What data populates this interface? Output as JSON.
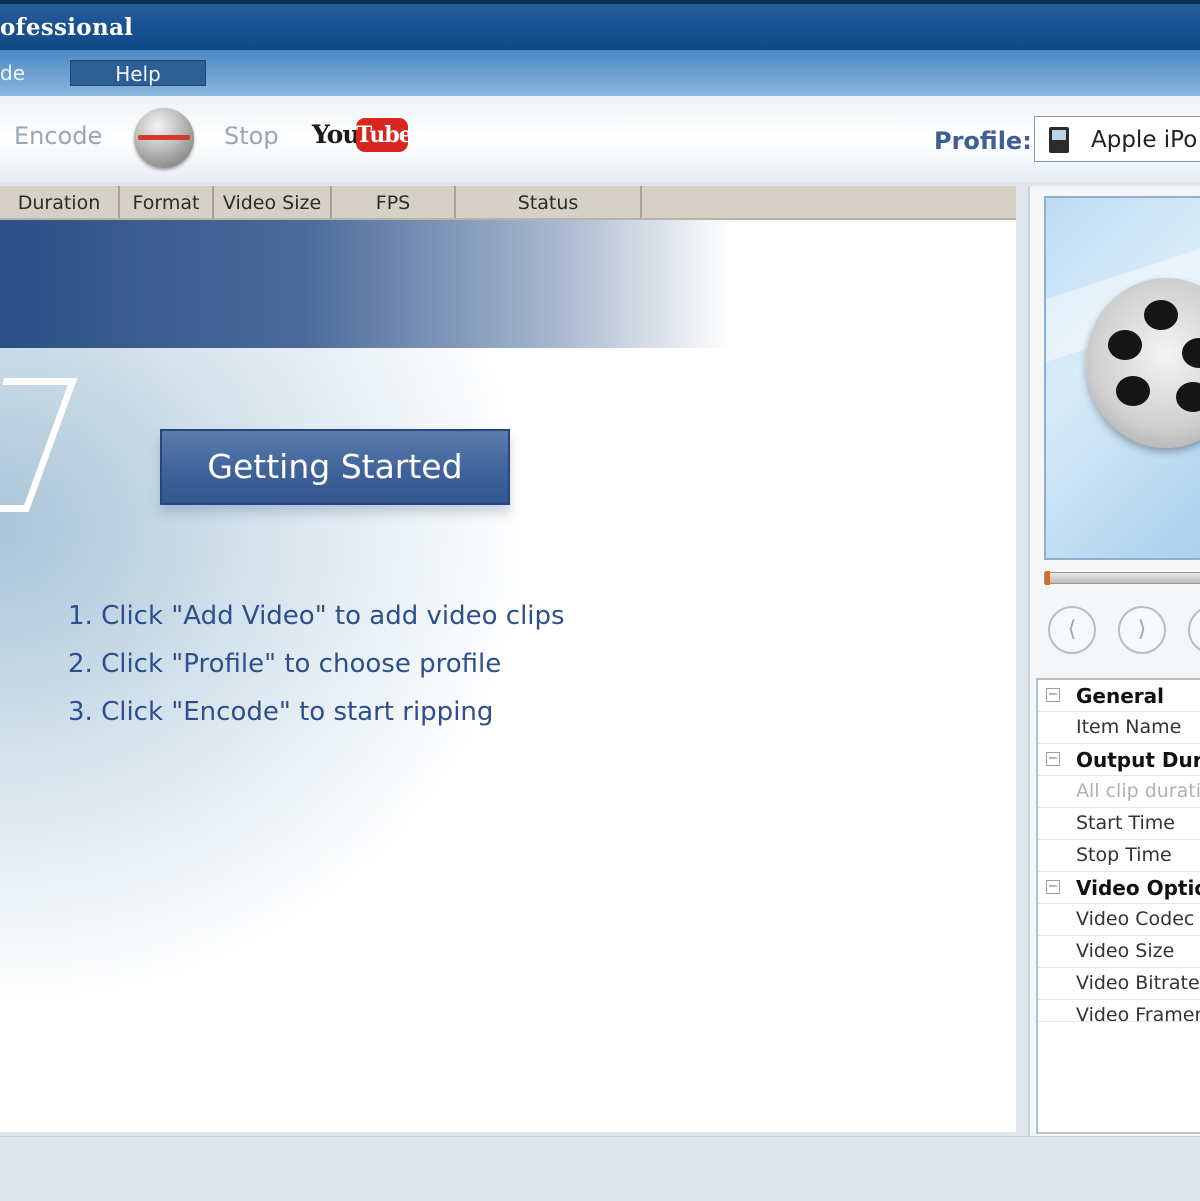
{
  "window": {
    "title": "ofessional"
  },
  "menu": {
    "mode_label": "de",
    "help_label": "Help"
  },
  "toolbar": {
    "encode_label": "Encode",
    "stop_label": "Stop",
    "youtube": {
      "you": "You",
      "tube": "Tube"
    },
    "record_icon": "record-icon",
    "profile_label": "Profile:",
    "profile_value": "Apple iPo",
    "profile_icon": "ipod-icon"
  },
  "file_list": {
    "columns": [
      "Duration",
      "Format",
      "Video Size",
      "FPS",
      "Status"
    ]
  },
  "welcome": {
    "button_label": "Getting Started",
    "steps": [
      "1. Click \"Add Video\" to add video clips",
      "2. Click \"Profile\" to choose profile",
      "3. Click \"Encode\" to start ripping"
    ]
  },
  "preview": {
    "image_icon": "film-reel-icon",
    "buttons": [
      {
        "icon": "snapshot-icon",
        "glyph": "⟨"
      },
      {
        "icon": "play-icon",
        "glyph": "⟩"
      },
      {
        "icon": "stop-icon",
        "glyph": ""
      }
    ]
  },
  "properties": {
    "rows": [
      {
        "label": "General",
        "group": true
      },
      {
        "label": "Item Name",
        "group": false
      },
      {
        "label": "Output Dura",
        "group": true
      },
      {
        "label": "All clip duratio",
        "group": false,
        "disabled": true
      },
      {
        "label": "Start Time",
        "group": false
      },
      {
        "label": "Stop Time",
        "group": false
      },
      {
        "label": "Video Optio",
        "group": true
      },
      {
        "label": "Video Codec",
        "group": false
      },
      {
        "label": "Video Size",
        "group": false
      },
      {
        "label": "Video Bitrate",
        "group": false
      },
      {
        "label": "Video Framer",
        "group": false
      }
    ]
  },
  "colors": {
    "titlebar": "#1d5595",
    "accent": "#3e6199",
    "youtube_red": "#d8251d",
    "step_text": "#2d4f8d"
  }
}
